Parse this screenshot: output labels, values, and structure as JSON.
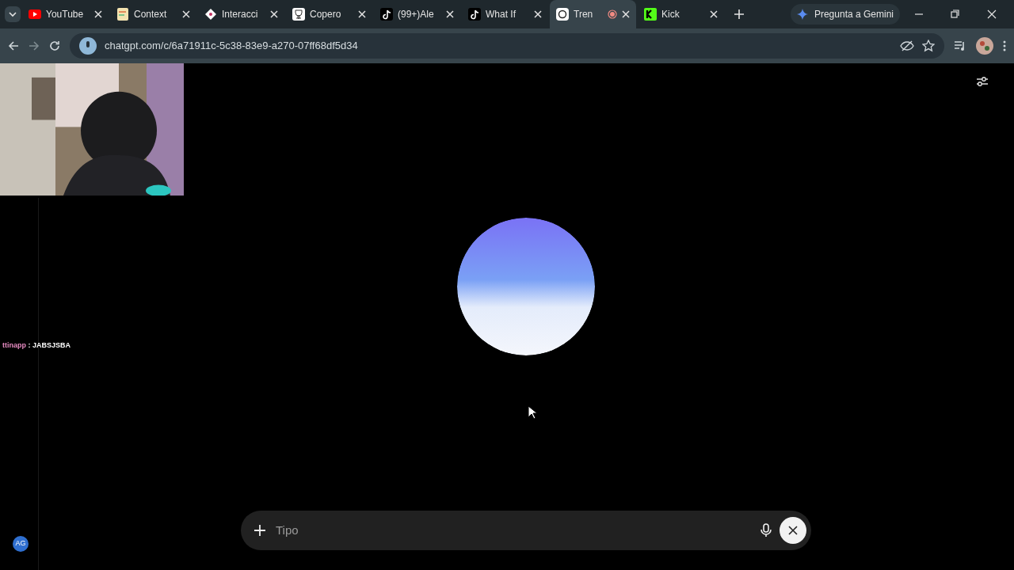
{
  "tabs": [
    {
      "title": "YouTube",
      "selected": false,
      "recording": false
    },
    {
      "title": "Context",
      "selected": false,
      "recording": false
    },
    {
      "title": "Interacci",
      "selected": false,
      "recording": false
    },
    {
      "title": "Copero",
      "selected": false,
      "recording": false
    },
    {
      "title": "(99+)Ale",
      "selected": false,
      "recording": false
    },
    {
      "title": "What If",
      "selected": false,
      "recording": false
    },
    {
      "title": "Tren",
      "selected": true,
      "recording": true
    },
    {
      "title": "Kick",
      "selected": false,
      "recording": false
    }
  ],
  "gemini": {
    "label": "Pregunta a Gemini"
  },
  "address": {
    "url": "chatgpt.com/c/6a71911c-5c38-83e9-a270-07ff68df5d34"
  },
  "chat_overlay": {
    "user": "ttinapp",
    "message": ": JABSJSBA"
  },
  "avatar": {
    "initials": "AG"
  },
  "composer": {
    "placeholder": "Tipo"
  }
}
